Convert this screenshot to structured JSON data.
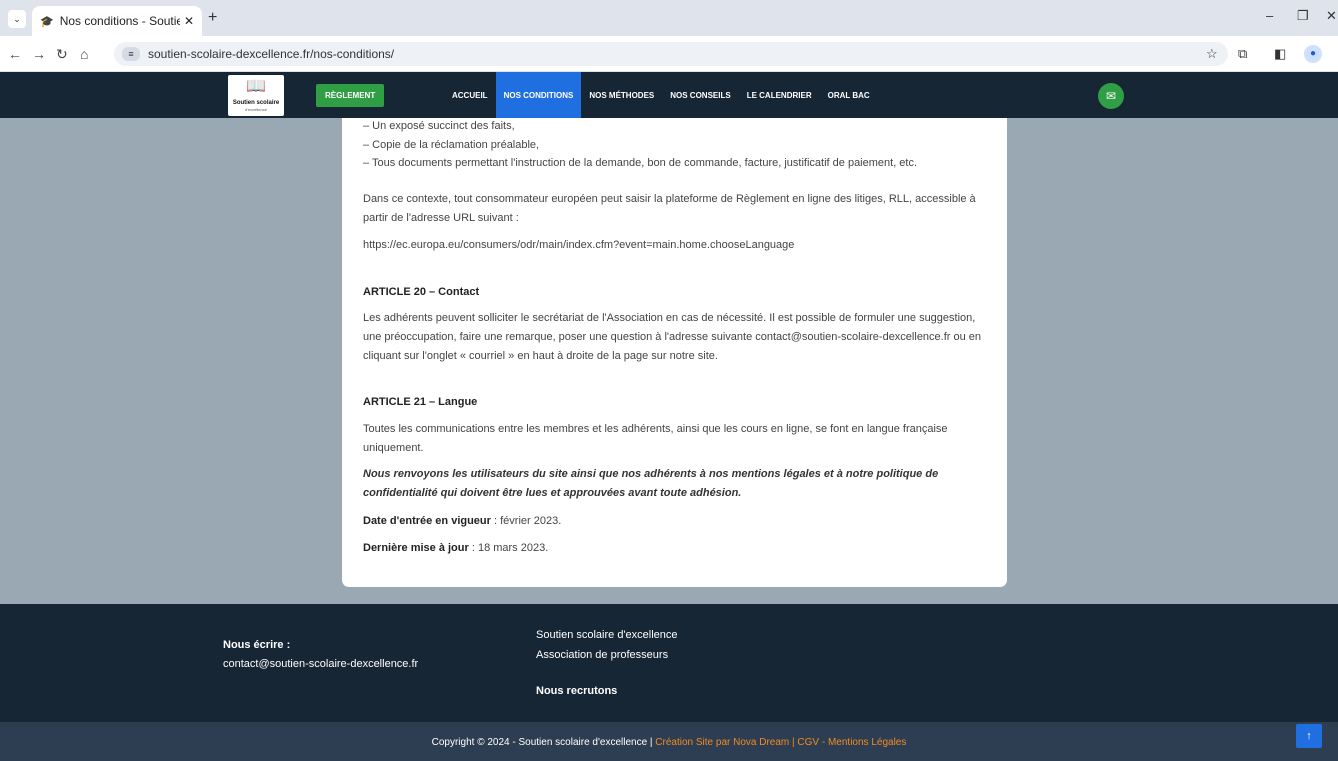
{
  "browser": {
    "tab_title": "Nos conditions - Soutien scolai",
    "url": "soutien-scolaire-dexcellence.fr/nos-conditions/"
  },
  "header": {
    "logo_name": "Soutien scolaire",
    "logo_sub": "d'excellence",
    "reglement": "RÈGLEMENT",
    "menu": [
      "ACCUEIL",
      "NOS CONDITIONS",
      "NOS MÉTHODES",
      "NOS CONSEILS",
      "LE CALENDRIER",
      "ORAL BAC"
    ],
    "active_index": 1
  },
  "content": {
    "list1": "– Un exposé succinct des faits,",
    "list2": "– Copie de la réclamation préalable,",
    "list3": "– Tous documents permettant l'instruction de la demande, bon de commande, facture, justificatif de paiement, etc.",
    "p_rll": "Dans ce contexte, tout consommateur européen peut saisir la plateforme de Règlement en ligne des litiges, RLL, accessible à partir de l'adresse URL suivant :",
    "url_rll": "https://ec.europa.eu/consumers/odr/main/index.cfm?event=main.home.chooseLanguage",
    "art20_title": "ARTICLE 20 – Contact",
    "art20_text": "Les adhérents peuvent solliciter le secrétariat de l'Association en cas de nécessité. Il est possible de formuler une suggestion, une préoccupation, faire une remarque, poser une question à l'adresse suivante contact@soutien-scolaire-dexcellence.fr ou en cliquant sur l'onglet « courriel » en haut à droite de la page sur notre site.",
    "art21_title": "ARTICLE 21 – Langue",
    "art21_text": "Toutes les communications entre les membres et les adhérents, ainsi que les cours en ligne, se font en langue française uniquement.",
    "notice": "Nous renvoyons les utilisateurs du site ainsi que nos adhérents à nos mentions légales et à notre politique de confidentialité qui doivent être lues et approuvées avant toute adhésion.",
    "date_label": "Date d'entrée en vigueur",
    "date_value": " : février 2023.",
    "update_label": "Dernière mise à jour",
    "update_value": " : 18 mars 2023."
  },
  "footer": {
    "write_label": "Nous écrire :",
    "email": "contact@soutien-scolaire-dexcellence.fr",
    "line1": "Soutien scolaire d'excellence",
    "line2": "Association de professeurs",
    "recruit": "Nous recrutons",
    "copyright": "Copyright © 2024 - Soutien scolaire d'excellence | ",
    "credit": "Création Site par Nova Dream",
    "sep": " | ",
    "cgv": "CGV",
    "dash": " - ",
    "legal": "Mentions Légales"
  }
}
